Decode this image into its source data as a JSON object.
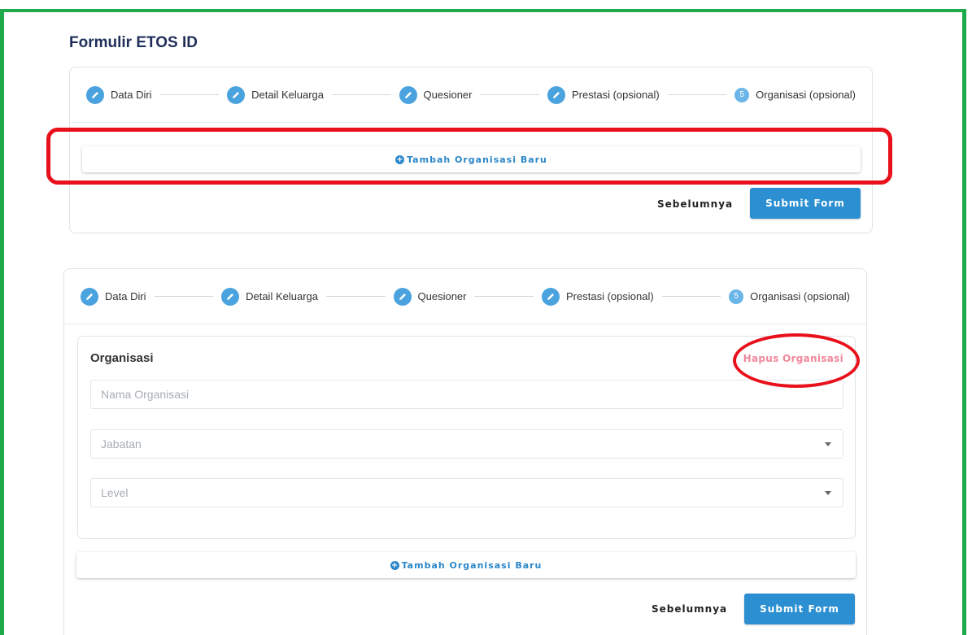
{
  "page": {
    "title": "Formulir ETOS ID"
  },
  "steps": [
    {
      "label": "Data Diri",
      "state": "done",
      "icon": "pencil-icon"
    },
    {
      "label": "Detail Keluarga",
      "state": "done",
      "icon": "pencil-icon"
    },
    {
      "label": "Quesioner",
      "state": "done",
      "icon": "pencil-icon"
    },
    {
      "label": "Prestasi (opsional)",
      "state": "done",
      "icon": "pencil-icon"
    },
    {
      "label": "Organisasi (opsional)",
      "state": "active",
      "number": "5"
    }
  ],
  "actions": {
    "add_org_label": "Tambah Organisasi Baru",
    "prev_label": "Sebelumnya",
    "submit_label": "Submit Form"
  },
  "organisasi": {
    "title": "Organisasi",
    "delete_label": "Hapus Organisasi",
    "name_placeholder": "Nama Organisasi",
    "jabatan_placeholder": "Jabatan",
    "level_placeholder": "Level"
  },
  "colors": {
    "accent": "#2b8fd1",
    "step_icon": "#4aa3df",
    "delete_text": "#f1879a",
    "annotation_red": "#e8101a",
    "frame_green": "#1ea94b"
  }
}
